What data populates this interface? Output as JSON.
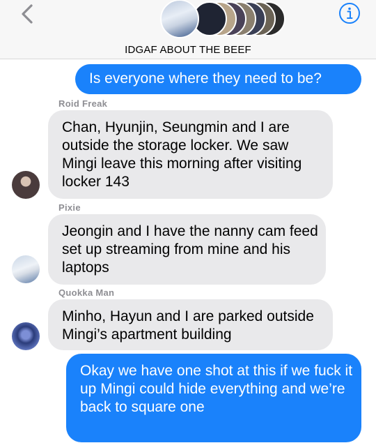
{
  "header": {
    "group_name": "IDGAF ABOUT THE BEEF",
    "back_icon": "chevron-left-icon",
    "info_icon": "info-icon"
  },
  "messages": [
    {
      "direction": "outgoing",
      "sender": "",
      "text": "Is everyone where they need to be?"
    },
    {
      "direction": "incoming",
      "sender": "Roid Freak",
      "text": "Chan, Hyunjin, Seungmin and I are outside the storage locker. We saw Mingi leave this morning after visiting locker 143"
    },
    {
      "direction": "incoming",
      "sender": "Pixie",
      "text": "Jeongin and I have the nanny cam feed set up streaming from mine and his laptops"
    },
    {
      "direction": "incoming",
      "sender": "Quokka Man",
      "text": "Minho, Hayun and I are parked outside Mingi’s apartment building"
    },
    {
      "direction": "outgoing",
      "sender": "",
      "text": "Okay we have one shot at this if we fuck it up Mingi could hide everything and we’re back to square one"
    }
  ],
  "colors": {
    "outgoing_bubble": "#1a82fb",
    "incoming_bubble": "#e9e9eb",
    "sender_name": "#8e8e93",
    "accent": "#1a82fb"
  }
}
